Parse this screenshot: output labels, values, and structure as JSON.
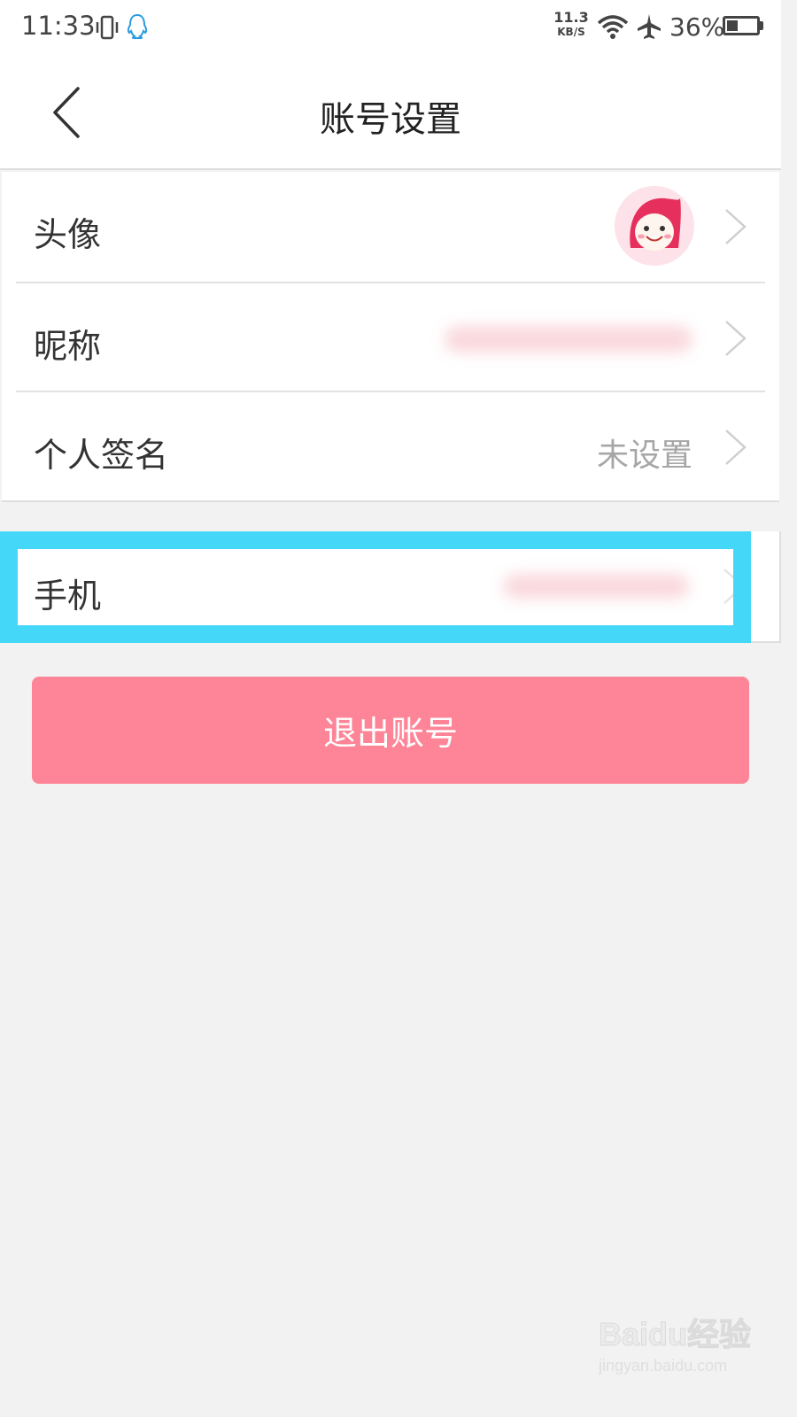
{
  "status_bar": {
    "time": "11:33",
    "net_speed_value": "11.3",
    "net_speed_unit": "KB/S",
    "battery_percent": "36%",
    "icons": [
      "vibrate-icon",
      "qq-icon",
      "wifi-icon",
      "airplane-mode-icon",
      "battery-icon"
    ]
  },
  "nav": {
    "title": "账号设置",
    "back_icon": "back-arrow-icon"
  },
  "profile_items": [
    {
      "label": "头像",
      "value_type": "avatar-image"
    },
    {
      "label": "昵称",
      "value_type": "blurred-text"
    },
    {
      "label": "个人签名",
      "value": "未设置"
    }
  ],
  "phone_item": {
    "label": "手机",
    "value_type": "blurred-text"
  },
  "logout_button": {
    "label": "退出账号"
  },
  "watermark": {
    "logo": "Baidu经验",
    "url": "jingyan.baidu.com"
  },
  "colors": {
    "background": "#f2f2f2",
    "logout_button": "#fe8597",
    "highlight_box": "#45d7f7",
    "secondary_text": "#a6a6a6"
  }
}
